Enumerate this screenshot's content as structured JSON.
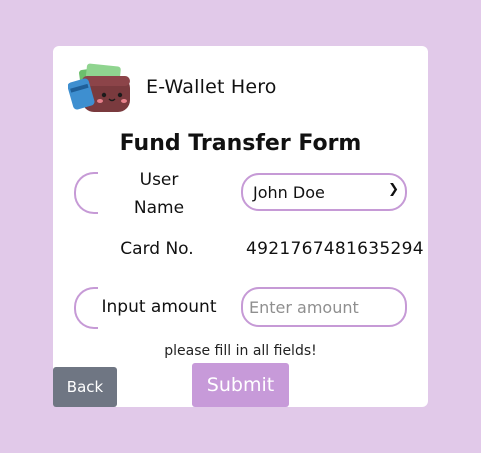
{
  "app": {
    "name": "E-Wallet Hero",
    "logo_icon": "wallet-mascot-icon"
  },
  "form": {
    "title": "Fund Transfer Form",
    "user_label_line1": "User",
    "user_label_line2": "Name",
    "user_select_value": "John Doe",
    "card_label": "Card No.",
    "card_value": "4921767481635294",
    "amount_label": "Input amount",
    "amount_placeholder": "Enter amount",
    "warning": "please fill in all fields!"
  },
  "buttons": {
    "back_label": "Back",
    "submit_label": "Submit"
  },
  "colors": {
    "background": "#e1c9e9",
    "accent": "#c79ad9",
    "back_button": "#6f7683"
  }
}
